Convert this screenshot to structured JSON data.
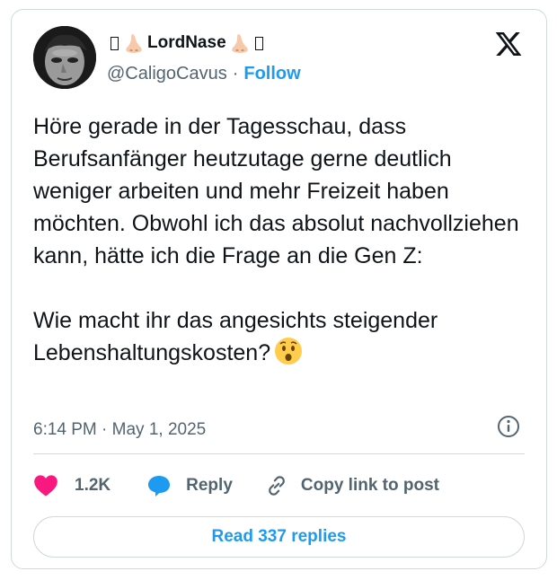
{
  "author": {
    "display_name": "LordNase",
    "handle": "@CaligoCavus",
    "follow_label": "Follow",
    "separator": "·"
  },
  "tweet": {
    "text": "Höre gerade in der Tagesschau, dass Berufsanfänger heutzutage gerne deutlich weniger arbeiten und mehr Freizeit haben möchten. Obwohl ich das absolut nachvollziehen kann, hätte ich die Frage an die Gen Z:\n\nWie macht ihr das angesichts steigender Lebenshaltungskosten?",
    "emoji": "hushed-face",
    "timestamp": "6:14 PM · May 1, 2025"
  },
  "actions": {
    "likes": "1.2K",
    "reply_label": "Reply",
    "copy_label": "Copy link to post"
  },
  "footer": {
    "read_replies_label": "Read 337 replies"
  },
  "colors": {
    "accent": "#1d9bf0",
    "like": "#f91880",
    "secondary_text": "#536471",
    "border": "#cfd9de"
  }
}
